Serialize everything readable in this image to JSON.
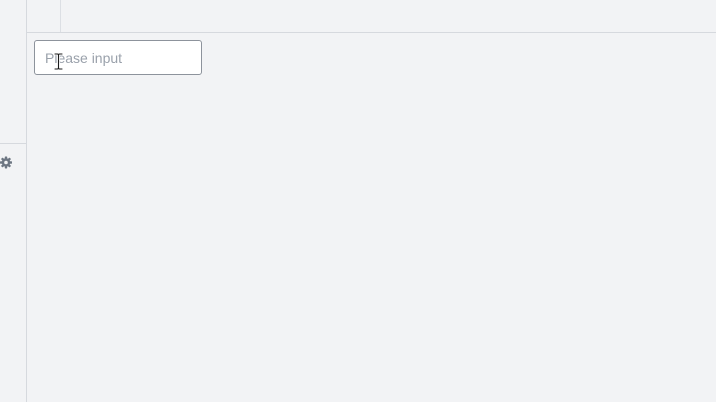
{
  "search": {
    "placeholder": "Please input",
    "value": ""
  },
  "icons": {
    "settings": "gear-icon",
    "pointer": "text-cursor-icon"
  },
  "colors": {
    "background": "#f2f3f5",
    "border": "#d6d9de",
    "input_border": "#8d939c",
    "placeholder": "#9aa1ab",
    "gear": "#6d7682"
  }
}
